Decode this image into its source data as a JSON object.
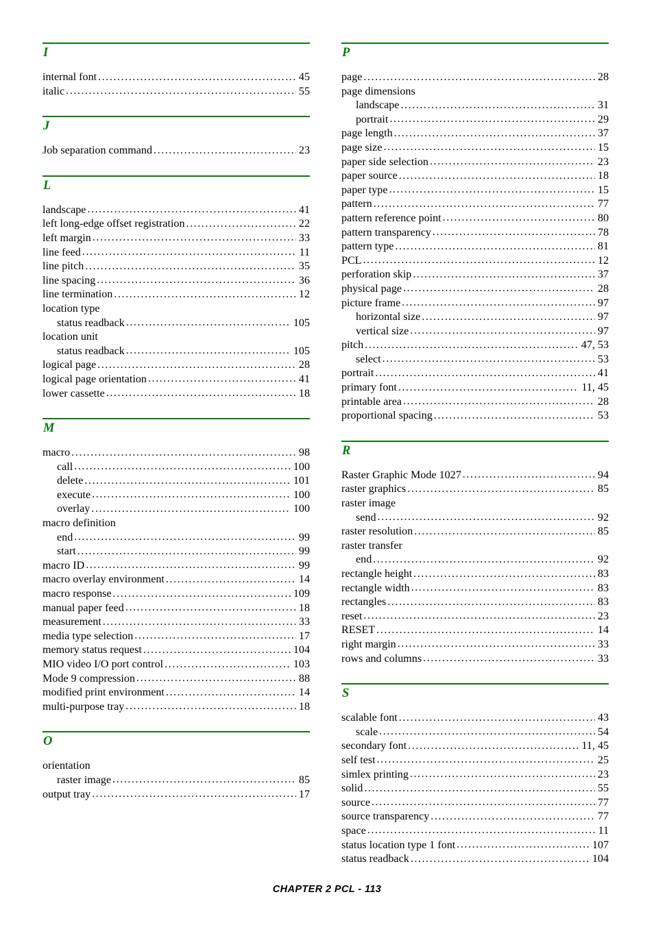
{
  "document": {
    "footer": "CHAPTER 2 PCL - 113",
    "accent_color": "#0b7a0b",
    "text_color": "#000000"
  },
  "columns": [
    {
      "name": "left-column",
      "sections": [
        {
          "letter": "I",
          "entries": [
            {
              "label": "internal font",
              "page": "45",
              "level": 0
            },
            {
              "label": "italic",
              "page": "55",
              "level": 0
            }
          ]
        },
        {
          "letter": "J",
          "entries": [
            {
              "label": "Job separation command",
              "page": "23",
              "level": 0
            }
          ]
        },
        {
          "letter": "L",
          "entries": [
            {
              "label": "landscape",
              "page": "41",
              "level": 0
            },
            {
              "label": "left long-edge offset registration",
              "page": "22",
              "level": 0
            },
            {
              "label": "left margin",
              "page": "33",
              "level": 0
            },
            {
              "label": "line feed",
              "page": "11",
              "level": 0
            },
            {
              "label": "line pitch",
              "page": "35",
              "level": 0
            },
            {
              "label": "line spacing",
              "page": "36",
              "level": 0
            },
            {
              "label": "line termination",
              "page": "12",
              "level": 0
            },
            {
              "label": "location type",
              "page": "",
              "level": 0
            },
            {
              "label": "status readback",
              "page": "105",
              "level": 1
            },
            {
              "label": "location unit",
              "page": "",
              "level": 0
            },
            {
              "label": "status readback",
              "page": "105",
              "level": 1
            },
            {
              "label": "logical page",
              "page": "28",
              "level": 0
            },
            {
              "label": "logical page orientation",
              "page": "41",
              "level": 0
            },
            {
              "label": "lower cassette",
              "page": "18",
              "level": 0
            }
          ]
        },
        {
          "letter": "M",
          "entries": [
            {
              "label": "macro",
              "page": "98",
              "level": 0
            },
            {
              "label": "call",
              "page": "100",
              "level": 1
            },
            {
              "label": "delete",
              "page": "101",
              "level": 1
            },
            {
              "label": "execute",
              "page": "100",
              "level": 1
            },
            {
              "label": "overlay",
              "page": "100",
              "level": 1
            },
            {
              "label": "macro definition",
              "page": "",
              "level": 0
            },
            {
              "label": "end",
              "page": "99",
              "level": 1
            },
            {
              "label": "start",
              "page": "99",
              "level": 1
            },
            {
              "label": "macro ID",
              "page": "99",
              "level": 0
            },
            {
              "label": "macro overlay environment",
              "page": "14",
              "level": 0
            },
            {
              "label": "macro response",
              "page": "109",
              "level": 0
            },
            {
              "label": "manual paper feed",
              "page": "18",
              "level": 0
            },
            {
              "label": "measurement",
              "page": "33",
              "level": 0
            },
            {
              "label": "media type selection",
              "page": "17",
              "level": 0
            },
            {
              "label": "memory status request",
              "page": "104",
              "level": 0
            },
            {
              "label": "MIO video I/O port control",
              "page": "103",
              "level": 0
            },
            {
              "label": "Mode 9 compression",
              "page": "88",
              "level": 0
            },
            {
              "label": "modified print environment",
              "page": "14",
              "level": 0
            },
            {
              "label": "multi-purpose tray",
              "page": "18",
              "level": 0
            }
          ]
        },
        {
          "letter": "O",
          "entries": [
            {
              "label": "orientation",
              "page": "",
              "level": 0
            },
            {
              "label": "raster image",
              "page": "85",
              "level": 1
            },
            {
              "label": "output tray",
              "page": "17",
              "level": 0
            }
          ]
        }
      ]
    },
    {
      "name": "right-column",
      "sections": [
        {
          "letter": "P",
          "entries": [
            {
              "label": "page",
              "page": "28",
              "level": 0
            },
            {
              "label": "page dimensions",
              "page": "",
              "level": 0
            },
            {
              "label": "landscape",
              "page": "31",
              "level": 1
            },
            {
              "label": "portrait",
              "page": "29",
              "level": 1
            },
            {
              "label": "page length",
              "page": "37",
              "level": 0
            },
            {
              "label": "page size",
              "page": "15",
              "level": 0
            },
            {
              "label": "paper side selection",
              "page": "23",
              "level": 0
            },
            {
              "label": "paper source",
              "page": "18",
              "level": 0
            },
            {
              "label": "paper type",
              "page": "15",
              "level": 0
            },
            {
              "label": "pattern",
              "page": "77",
              "level": 0
            },
            {
              "label": "pattern reference point",
              "page": "80",
              "level": 0
            },
            {
              "label": "pattern transparency",
              "page": "78",
              "level": 0
            },
            {
              "label": "pattern type",
              "page": "81",
              "level": 0
            },
            {
              "label": "PCL",
              "page": "12",
              "level": 0
            },
            {
              "label": "perforation skip",
              "page": "37",
              "level": 0
            },
            {
              "label": "physical page",
              "page": "28",
              "level": 0
            },
            {
              "label": "picture frame",
              "page": "97",
              "level": 0
            },
            {
              "label": "horizontal size",
              "page": "97",
              "level": 1
            },
            {
              "label": "vertical size",
              "page": "97",
              "level": 1
            },
            {
              "label": "pitch",
              "page": "47, 53",
              "level": 0
            },
            {
              "label": "select",
              "page": "53",
              "level": 1
            },
            {
              "label": "portrait",
              "page": "41",
              "level": 0
            },
            {
              "label": "primary font",
              "page": "11, 45",
              "level": 0
            },
            {
              "label": "printable area",
              "page": "28",
              "level": 0
            },
            {
              "label": "proportional spacing",
              "page": "53",
              "level": 0
            }
          ]
        },
        {
          "letter": "R",
          "entries": [
            {
              "label": "Raster Graphic Mode 1027",
              "page": "94",
              "level": 0
            },
            {
              "label": "raster graphics",
              "page": "85",
              "level": 0
            },
            {
              "label": "raster image",
              "page": "",
              "level": 0
            },
            {
              "label": "send",
              "page": "92",
              "level": 1
            },
            {
              "label": "raster resolution",
              "page": "85",
              "level": 0
            },
            {
              "label": "raster transfer",
              "page": "",
              "level": 0
            },
            {
              "label": "end",
              "page": "92",
              "level": 1
            },
            {
              "label": "rectangle height",
              "page": "83",
              "level": 0
            },
            {
              "label": "rectangle width",
              "page": "83",
              "level": 0
            },
            {
              "label": "rectangles",
              "page": "83",
              "level": 0
            },
            {
              "label": "reset",
              "page": "23",
              "level": 0
            },
            {
              "label": "RESET",
              "page": "14",
              "level": 0
            },
            {
              "label": "right margin",
              "page": "33",
              "level": 0
            },
            {
              "label": "rows and columns",
              "page": "33",
              "level": 0
            }
          ]
        },
        {
          "letter": "S",
          "entries": [
            {
              "label": "scalable font",
              "page": "43",
              "level": 0
            },
            {
              "label": "scale",
              "page": "54",
              "level": 1
            },
            {
              "label": "secondary font",
              "page": "11, 45",
              "level": 0
            },
            {
              "label": "self test",
              "page": "25",
              "level": 0
            },
            {
              "label": "simlex printing",
              "page": "23",
              "level": 0
            },
            {
              "label": "solid",
              "page": "55",
              "level": 0
            },
            {
              "label": "source",
              "page": "77",
              "level": 0
            },
            {
              "label": "source transparency",
              "page": "77",
              "level": 0
            },
            {
              "label": "space",
              "page": "11",
              "level": 0
            },
            {
              "label": "status location type 1 font",
              "page": "107",
              "level": 0
            },
            {
              "label": "status readback",
              "page": "104",
              "level": 0
            }
          ]
        }
      ]
    }
  ]
}
